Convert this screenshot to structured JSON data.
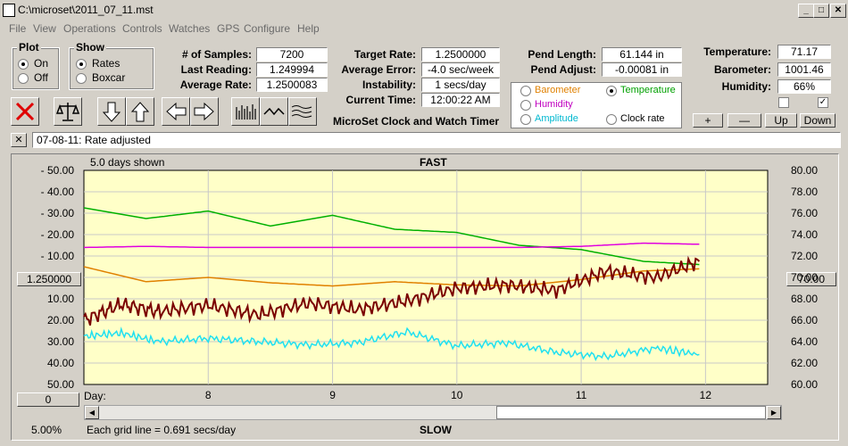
{
  "window": {
    "title": "C:\\microset\\2011_07_11.mst"
  },
  "menu": [
    "File",
    "View",
    "Operations",
    "Controls",
    "Watches",
    "GPS",
    "Configure",
    "Help"
  ],
  "plot_group": {
    "title": "Plot",
    "on": "On",
    "off": "Off",
    "selected": "On"
  },
  "show_group": {
    "title": "Show",
    "rates": "Rates",
    "boxcar": "Boxcar",
    "selected": "Rates"
  },
  "stats": {
    "samples_label": "# of Samples:",
    "samples": "7200",
    "last_reading_label": "Last Reading:",
    "last_reading": "1.249994",
    "average_rate_label": "Average Rate:",
    "average_rate": "1.2500083",
    "target_rate_label": "Target Rate:",
    "target_rate": "1.2500000",
    "average_error_label": "Average Error:",
    "average_error": "-4.0 sec/week",
    "instability_label": "Instability:",
    "instability": "1 secs/day",
    "current_time_label": "Current Time:",
    "current_time": "12:00:22 AM",
    "pend_length_label": "Pend Length:",
    "pend_length": "61.144 in",
    "pend_adjust_label": "Pend Adjust:",
    "pend_adjust": "-0.00081 in",
    "temperature_label": "Temperature:",
    "temperature": "71.17",
    "barometer_label": "Barometer:",
    "barometer": "1001.46",
    "humidity_label": "Humidity:",
    "humidity": "66%"
  },
  "app_name": "MicroSet Clock and Watch Timer",
  "sensor_select": {
    "barometer": "Barometer",
    "temperature": "Temperature",
    "humidity": "Humidity",
    "amplitude": "Amplitude",
    "clock_rate": "Clock rate",
    "selected": "Temperature",
    "colors": {
      "barometer": "#e08000",
      "temperature": "#00a000",
      "humidity": "#c000c0",
      "amplitude": "#00c8d8",
      "clock_rate": "#000000"
    }
  },
  "plot_buttons": {
    "plus": "+",
    "minus": "—",
    "up": "Up",
    "down": "Down"
  },
  "log": {
    "close": "✕",
    "message": "07-08-11: Rate adjusted"
  },
  "chart": {
    "days_shown": "5.0 days shown",
    "top_label": "FAST",
    "bottom_label": "SLOW",
    "center_rate": "1.250000",
    "center_temp": "70.00",
    "offset_value": "0",
    "zoom": "5.00%",
    "grid_note": "Each grid line = 0.691 secs/day",
    "day_label": "Day:"
  },
  "chart_data": {
    "type": "line",
    "xlabel": "Day:",
    "x_ticks": [
      "8",
      "9",
      "10",
      "11",
      "12"
    ],
    "left_ticks": [
      "- 50.00",
      "- 40.00",
      "- 30.00",
      "- 20.00",
      "- 10.00",
      "10.00",
      "20.00",
      "30.00",
      "40.00",
      "50.00"
    ],
    "right_ticks": [
      "80.00",
      "78.00",
      "76.00",
      "74.00",
      "72.00",
      "70.00",
      "68.00",
      "66.00",
      "64.00",
      "62.00",
      "60.00"
    ],
    "xlim": [
      7,
      12.5
    ],
    "right_ylim": [
      60,
      80
    ],
    "series": [
      {
        "name": "Temperature",
        "color": "#00b000",
        "x": [
          7.0,
          7.5,
          8.0,
          8.5,
          9.0,
          9.5,
          10.0,
          10.5,
          11.0,
          11.5,
          11.95
        ],
        "y": [
          76.5,
          75.5,
          76.2,
          74.8,
          75.8,
          74.5,
          74.2,
          73.0,
          72.6,
          71.5,
          71.2
        ]
      },
      {
        "name": "Humidity",
        "color": "#e000e0",
        "x": [
          7.0,
          7.5,
          8.0,
          8.5,
          9.0,
          9.5,
          10.0,
          10.5,
          11.0,
          11.5,
          11.95
        ],
        "y": [
          72.8,
          72.9,
          72.8,
          72.8,
          72.8,
          72.8,
          72.8,
          72.8,
          72.9,
          73.2,
          73.1
        ]
      },
      {
        "name": "Barometer",
        "color": "#e08000",
        "x": [
          7.0,
          7.5,
          8.0,
          8.5,
          9.0,
          9.5,
          10.0,
          10.5,
          11.0,
          11.5,
          11.95
        ],
        "y": [
          71.0,
          69.6,
          70.0,
          69.5,
          69.2,
          69.6,
          69.3,
          69.2,
          69.8,
          70.6,
          70.8
        ]
      },
      {
        "name": "Clock rate",
        "color": "#7a0000",
        "x": [
          7.0,
          7.3,
          7.6,
          8.0,
          8.4,
          8.8,
          9.2,
          9.6,
          10.0,
          10.4,
          10.8,
          11.2,
          11.6,
          11.95
        ],
        "y": [
          66.0,
          67.5,
          66.8,
          67.4,
          66.5,
          67.6,
          67.0,
          67.8,
          69.0,
          69.3,
          68.8,
          70.6,
          70.0,
          71.5
        ]
      },
      {
        "name": "Amplitude",
        "color": "#20e0f0",
        "x": [
          7.0,
          7.3,
          7.6,
          8.0,
          8.4,
          8.8,
          9.2,
          9.6,
          10.0,
          10.4,
          10.8,
          11.2,
          11.6,
          11.95
        ],
        "y": [
          64.5,
          64.8,
          64.0,
          64.3,
          64.0,
          63.7,
          63.9,
          64.9,
          63.6,
          63.9,
          63.0,
          62.6,
          63.4,
          62.8
        ]
      }
    ]
  }
}
